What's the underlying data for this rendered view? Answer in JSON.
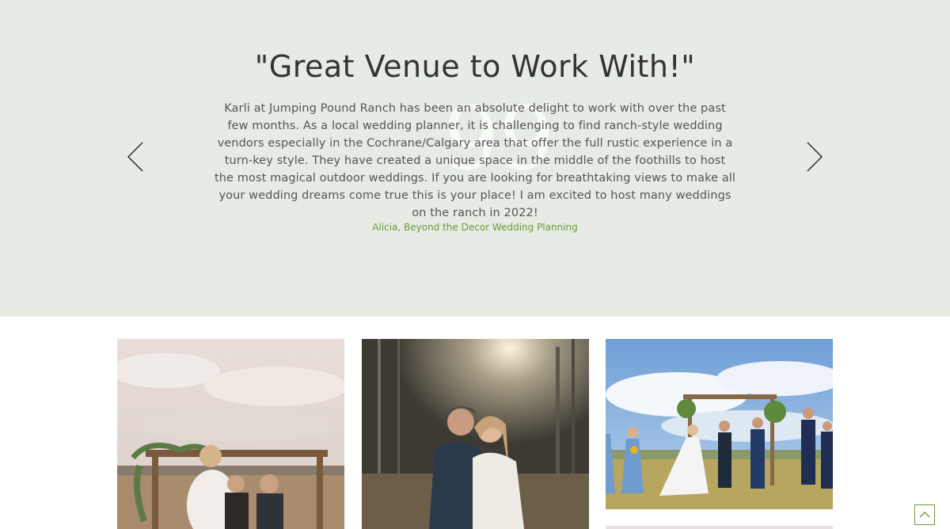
{
  "testimonial": {
    "title": "\"Great Venue to Work With!\"",
    "quote_mark": "99",
    "body": "Karli at Jumping Pound Ranch has been an absolute delight to work with over the past few months. As a local wedding planner, it is challenging to find ranch-style wedding vendors especially in the Cochrane/Calgary area that offer the full rustic experience in a turn-key style. They have created a unique space in the middle of the foothills to host the most magical outdoor weddings. If you are looking for breathtaking views to make all your wedding dreams come true this is your place! I am excited to host many weddings on the ranch in 2022!",
    "author": "Alicia, Beyond the Decor Wedding Planning",
    "prev_icon": "chevron-left-icon",
    "next_icon": "chevron-right-icon"
  },
  "colors": {
    "band_background": "#e6ebe4",
    "accent_green": "#6b9a3e",
    "title_text": "#333333",
    "body_text": "#555555"
  },
  "gallery": {
    "images": [
      {
        "subject": "bride-and-groom-with-officiant-under-wooden-arch-on-prairie"
      },
      {
        "subject": "couple-embracing-in-forest-at-sunset"
      },
      {
        "subject": "outdoor-ceremony-with-bridesmaids-and-groomsmen-under-blue-sky"
      }
    ]
  },
  "back_to_top": {
    "icon": "chevron-up-icon"
  }
}
